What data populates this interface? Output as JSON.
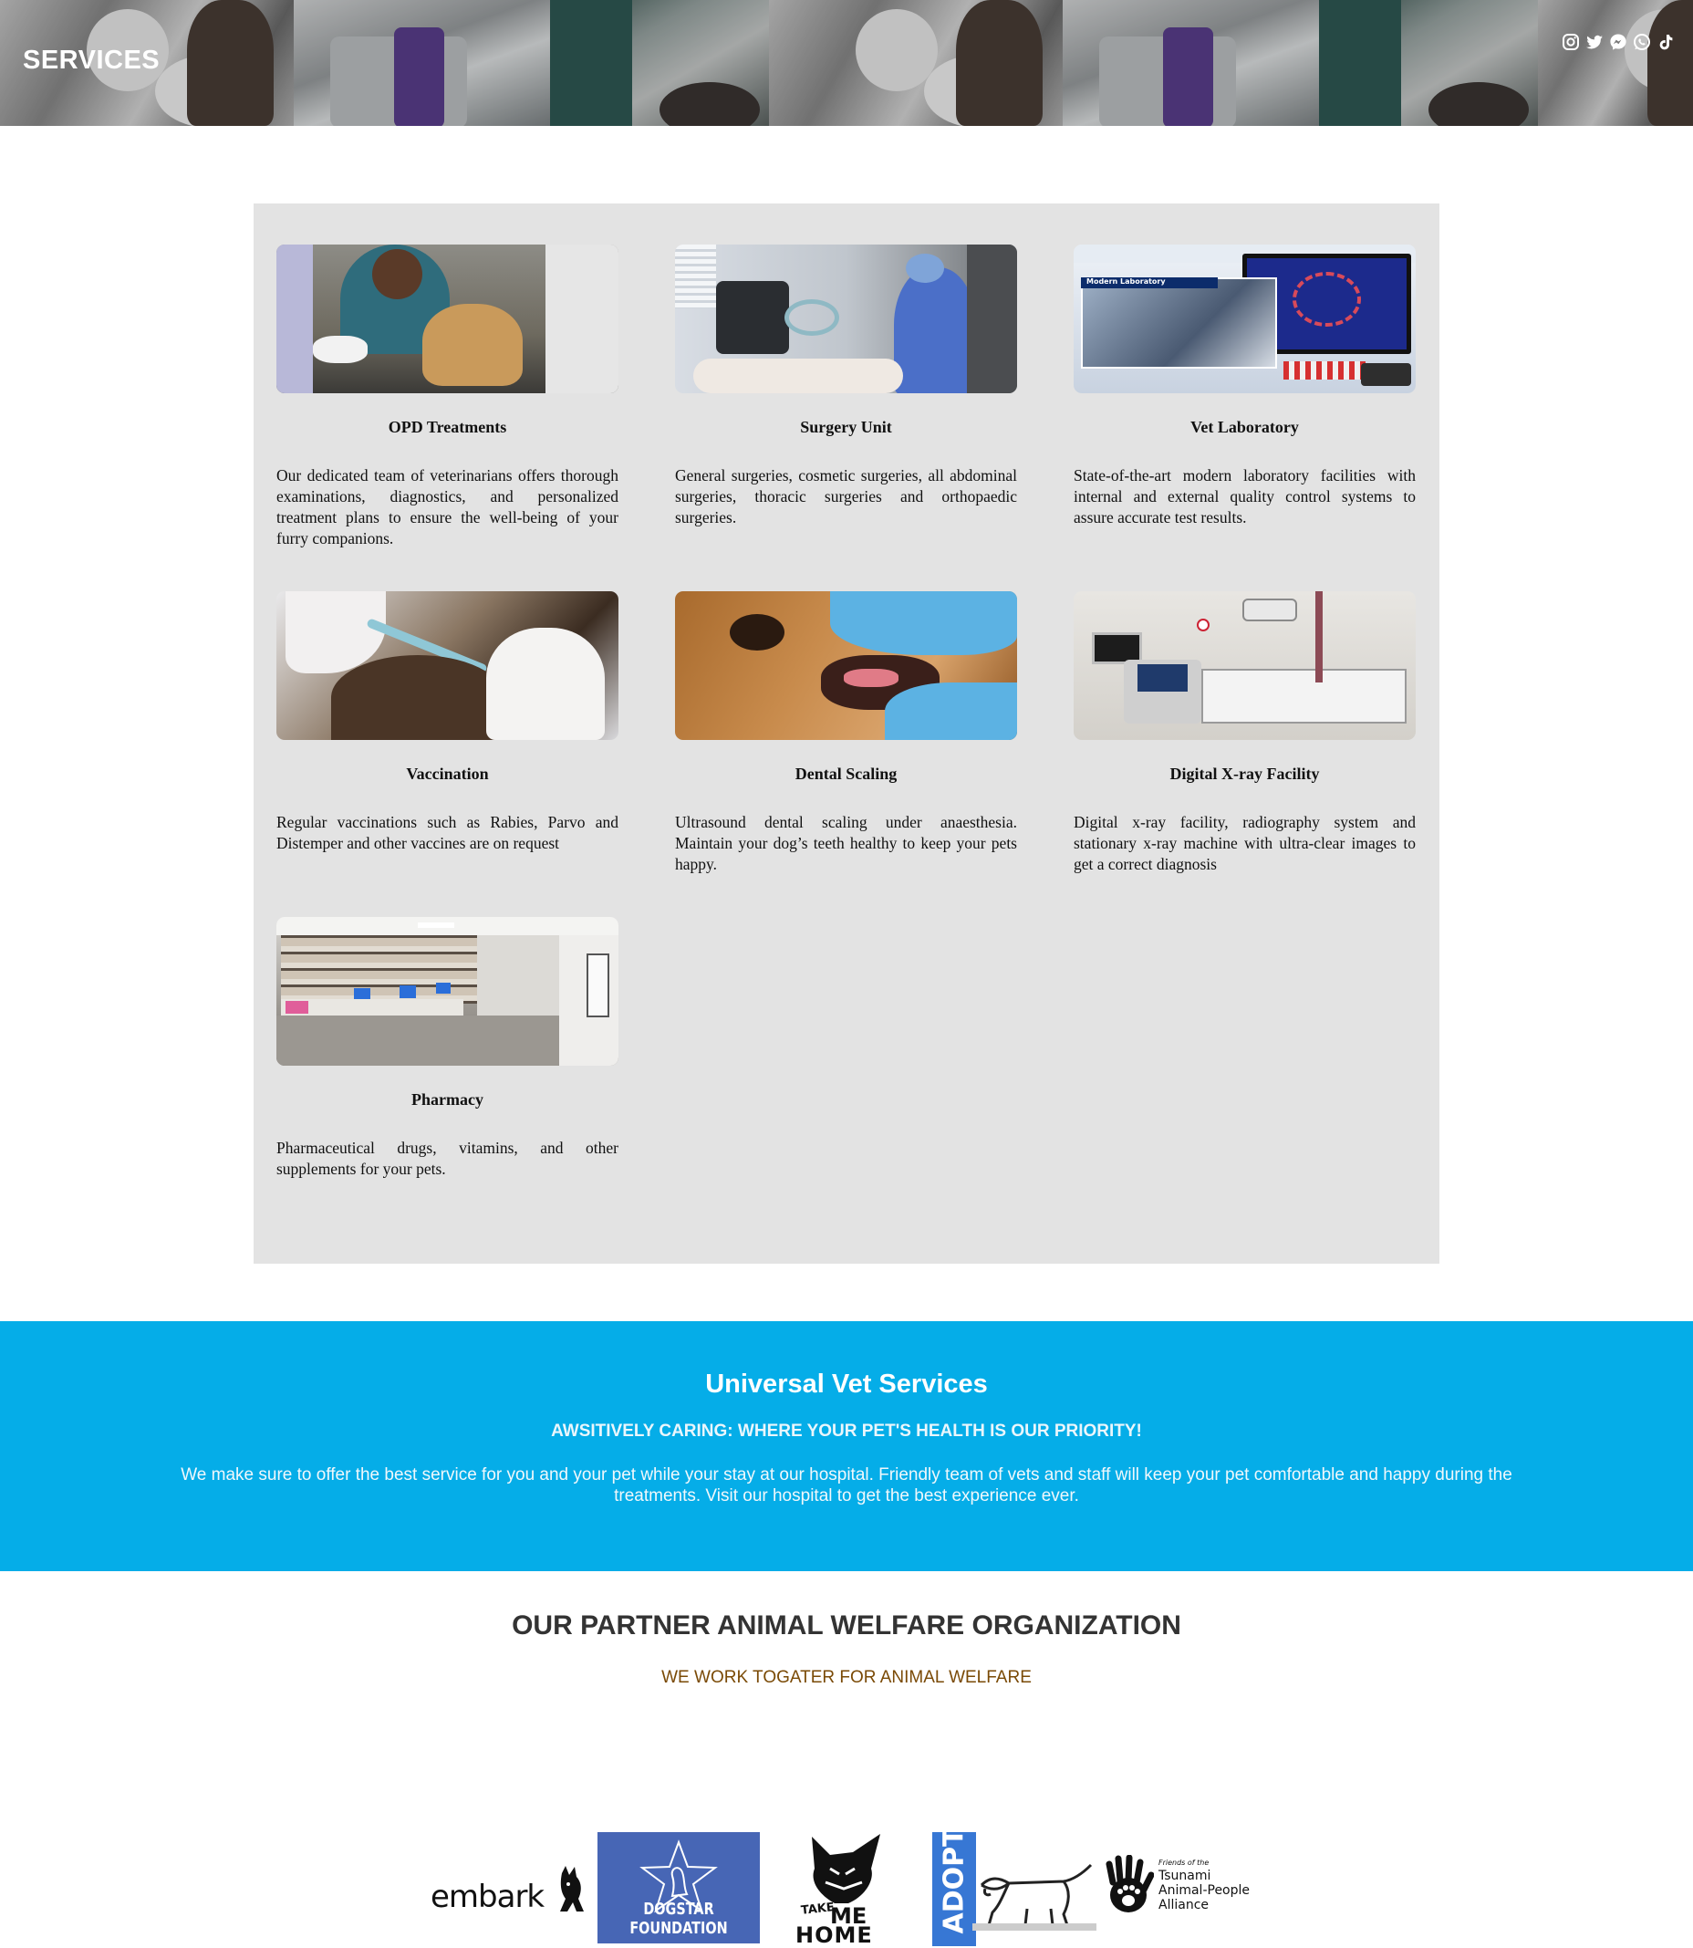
{
  "header": {
    "title": "SERVICES",
    "social_icons": [
      "instagram-icon",
      "twitter-icon",
      "messenger-icon",
      "whatsapp-icon",
      "tiktok-icon"
    ]
  },
  "services": [
    {
      "title": "OPD Treatments",
      "description": "Our dedicated team of veterinarians offers thorough examinations, diagnostics, and personalized treatment plans to ensure the well-being of your furry companions."
    },
    {
      "title": "Surgery Unit",
      "description": "General surgeries, cosmetic surgeries, all abdominal surgeries, thoracic surgeries and orthopaedic surgeries."
    },
    {
      "title": "Vet Laboratory",
      "description": "State-of-the-art modern laboratory facilities with internal and external quality control systems to assure accurate test results.",
      "image_caption": "Modern Laboratory"
    },
    {
      "title": "Vaccination",
      "description": "Regular vaccinations such as Rabies, Parvo and Distemper and other vaccines are on request"
    },
    {
      "title": "Dental Scaling",
      "description": "Ultrasound dental scaling under anaesthesia. Maintain your dog’s teeth healthy to keep your pets happy."
    },
    {
      "title": "Digital X-ray Facility",
      "description": "Digital x-ray facility, radiography system and stationary x-ray machine with ultra-clear images to get a correct diagnosis"
    },
    {
      "title": "Pharmacy",
      "description": "Pharmaceutical drugs, vitamins, and other supplements for your pets."
    }
  ],
  "about": {
    "title": "Universal Vet Services",
    "tagline": "AWSITIVELY CARING: WHERE YOUR PET'S HEALTH IS OUR PRIORITY!",
    "text": "We make sure to offer the best service for you and your pet while your stay at our hospital. Friendly team of vets and staff will keep your pet comfortable and happy during the treatments. Visit our hospital to get the best experience ever."
  },
  "partners": {
    "title": "OUR PARTNER ANIMAL WELFARE ORGANIZATION",
    "subtitle": "WE WORK TOGATER FOR ANIMAL WELFARE",
    "logos": [
      {
        "name": "embark",
        "text": "embark"
      },
      {
        "name": "dogstar",
        "text": "DOGSTAR FOUNDATION"
      },
      {
        "name": "take-me-home",
        "line1": "TAKE",
        "line2": "ME",
        "line3": "HOME"
      },
      {
        "name": "adopt",
        "text": "ADOPT"
      },
      {
        "name": "tsunami",
        "line1": "Friends of the",
        "line2": "Tsunami",
        "line3": "Animal-People",
        "line4": "Alliance"
      }
    ]
  },
  "colors": {
    "accent_blue": "#05ade8",
    "panel_gray": "#e3e3e3",
    "subtitle_brown": "#7a4a06"
  }
}
